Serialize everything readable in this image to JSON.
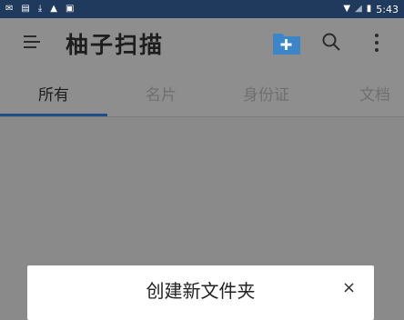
{
  "status_bar": {
    "time": "5:43",
    "left_icons": [
      "sms-icon",
      "message-icon",
      "download-icon",
      "warning-icon",
      "image-icon"
    ],
    "right_icons": [
      "wifi-icon",
      "signal-icon",
      "battery-icon"
    ]
  },
  "app_bar": {
    "title": "柚子扫描",
    "icons": [
      "menu-icon",
      "folder-add-icon",
      "search-icon",
      "more-vert-icon"
    ]
  },
  "tabs": [
    {
      "label": "所有",
      "active": true
    },
    {
      "label": "名片",
      "active": false
    },
    {
      "label": "身份证",
      "active": false
    },
    {
      "label": "文档",
      "active": false
    }
  ],
  "dialog": {
    "title": "创建新文件夹",
    "close": "×"
  },
  "colors": {
    "status_bar": "#1f3a5c",
    "accent": "#1e4f86",
    "folder_icon": "#3c86c8",
    "scrim": "#8a8a8a"
  }
}
